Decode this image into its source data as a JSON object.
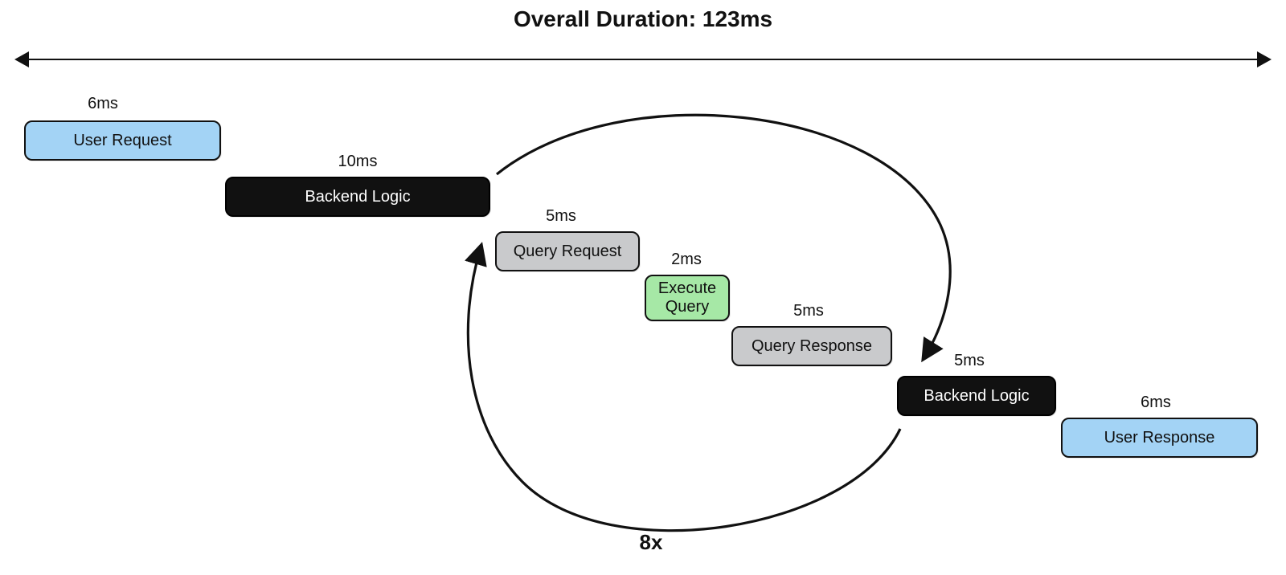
{
  "title": "Overall Duration: 123ms",
  "loop_label": "8x",
  "blocks": {
    "user_request": {
      "label": "User Request",
      "duration": "6ms"
    },
    "backend_logic_1": {
      "label": "Backend Logic",
      "duration": "10ms"
    },
    "query_request": {
      "label": "Query Request",
      "duration": "5ms"
    },
    "execute_query": {
      "label": "Execute\nQuery",
      "duration": "2ms"
    },
    "query_response": {
      "label": "Query Response",
      "duration": "5ms"
    },
    "backend_logic_2": {
      "label": "Backend Logic",
      "duration": "5ms"
    },
    "user_response": {
      "label": "User Response",
      "duration": "6ms"
    }
  },
  "colors": {
    "blue": "#a3d3f5",
    "black": "#111111",
    "gray": "#c9cacc",
    "green": "#a6e8a6"
  }
}
